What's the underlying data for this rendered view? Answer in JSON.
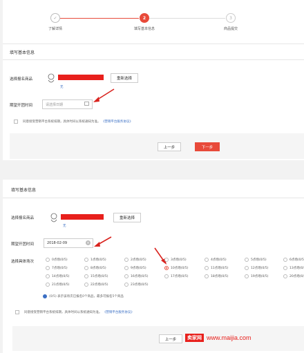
{
  "stepper": {
    "steps": [
      {
        "num": "✓",
        "label": "了解详情"
      },
      {
        "num": "2",
        "label": "填写基本信息"
      },
      {
        "num": "3",
        "label": "商品提交"
      }
    ]
  },
  "form1": {
    "section_title": "填写基本信息",
    "product_label": "选择报名商品",
    "product_tag": "无",
    "reselect_button": "重新选择",
    "date_label": "期望开团时间",
    "date_placeholder": "请选择日期",
    "agree_text": "同意接受营销平台系统排期，具体时间以系统通知为准。",
    "agree_link": "《营销平台服务协议》",
    "prev_button": "上一步",
    "next_button": "下一步"
  },
  "form2": {
    "section_title": "填写基本信息",
    "product_label": "选择报名商品",
    "product_tag": "无",
    "reselect_button": "重新选择",
    "date_label": "期望开团时间",
    "date_value": "2018-02-09",
    "slot_label": "选择具体场次",
    "slots": [
      [
        "0点场(0/5)",
        "1点场(0/5)",
        "2点场(0/5)",
        "3点场(0/5)",
        "4点场(0/5)",
        "5点场(0/5)",
        "6点场(0/5)"
      ],
      [
        "7点场(0/5)",
        "8点场(0/5)",
        "9点场(0/5)",
        "10点场(0/5)",
        "11点场(0/5)",
        "12点场(0/5)",
        "13点场(0/5)"
      ],
      [
        "14点场(0/5)",
        "15点场(0/5)",
        "16点场(0/5)",
        "17点场(0/5)",
        "18点场(0/5)",
        "19点场(0/5)",
        "20点场(0/5)"
      ],
      [
        "21点场(0/5)",
        "22点场(0/5)",
        "23点场(0/5)"
      ]
    ],
    "selected_slot": "10点场(0/5)",
    "note": "(0/5) 表示该场次已报名0个商品，最多可报名5个商品",
    "agree_text": "同意接受营销平台系统排期，具体时间以系统通知为准。",
    "agree_link": "《营销平台服务协议》",
    "prev_button": "上一步"
  },
  "watermark": {
    "brand": "卖家网",
    "url": "www.maijia.com"
  },
  "colors": {
    "accent": "#e84a3a",
    "link": "#3b6fc4",
    "redacted": "#e8201c"
  }
}
